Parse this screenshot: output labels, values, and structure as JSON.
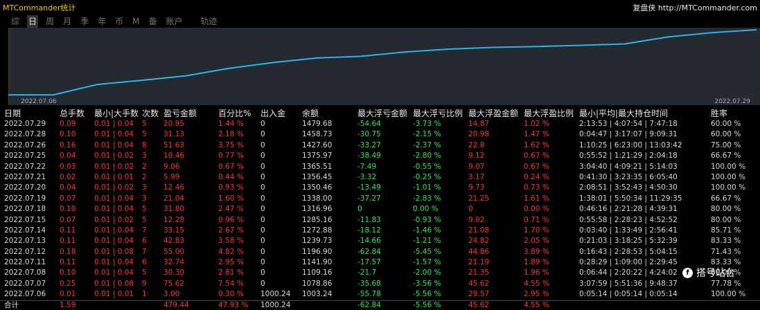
{
  "app_title": "MTCommander统计",
  "brand": {
    "name": "复盘侠",
    "url": "http://MTCommander.com"
  },
  "tabs": [
    "综",
    "日",
    "周",
    "月",
    "季",
    "年",
    "币",
    "M",
    "备",
    "账户",
    "轨迹"
  ],
  "active_tab": "日",
  "chart": {
    "start_date": "2022.07.06",
    "end_date": "2022.07.29",
    "line_color": "#29b6f0"
  },
  "columns": [
    "日期",
    "总手数",
    "最小|大手数",
    "次数",
    "盈亏金额",
    "百分比%",
    "出入金",
    "余额",
    "最大浮亏金额",
    "最大浮亏比例",
    "最大浮盈金额",
    "最大浮盈比例",
    "最小|平均|最大持仓时间",
    "胜率"
  ],
  "rows": [
    [
      "2022.07.29",
      "0.09",
      "0.01 | 0.04",
      "5",
      "20.95",
      "1.44 %",
      "0",
      "1479.68",
      "-54.64",
      "-3.73 %",
      "14.87",
      "1.02 %",
      "2:13:53 | 4:07:54 | 7:47:18",
      "60.00 %"
    ],
    [
      "2022.07.28",
      "0.10",
      "0.01 | 0.04",
      "5",
      "31.13",
      "2.18 %",
      "0",
      "1458.73",
      "-30.75",
      "-2.15 %",
      "20.98",
      "1.47 %",
      "0:04:47 | 3:17:07 | 9:09:31",
      "60.00 %"
    ],
    [
      "2022.07.26",
      "0.16",
      "0.01 | 0.04",
      "8",
      "51.63",
      "3.75 %",
      "0",
      "1427.60",
      "-33.27",
      "-2.37 %",
      "22.8",
      "1.62 %",
      "1:10:25 | 6:23:00 | 13:03:42",
      "75.00 %"
    ],
    [
      "2022.07.25",
      "0.04",
      "0.01 | 0.02",
      "3",
      "10.46",
      "0.77 %",
      "0",
      "1375.97",
      "-38.49",
      "-2.80 %",
      "9.12",
      "0.67 %",
      "0:55:52 | 1:21:29 | 2:04:18",
      "66.67 %"
    ],
    [
      "2022.07.22",
      "0.03",
      "0.01 | 0.02",
      "2",
      "9.06",
      "0.67 %",
      "0",
      "1365.51",
      "-7.49",
      "-0.55 %",
      "9.07",
      "0.67 %",
      "3:04:40 | 4:09:21 | 5:14:03",
      "100.00 %"
    ],
    [
      "2022.07.21",
      "0.02",
      "0.01 | 0.01",
      "2",
      "5.99",
      "0.44 %",
      "0",
      "1356.45",
      "-3.32",
      "-0.25 %",
      "3.17",
      "0.24 %",
      "0:41:30 | 3:23:35 | 6:05:40",
      "100.00 %"
    ],
    [
      "2022.07.20",
      "0.04",
      "0.01 | 0.02",
      "3",
      "12.46",
      "0.93 %",
      "0",
      "1350.46",
      "-13.49",
      "-1.01 %",
      "9.73",
      "0.73 %",
      "2:08:51 | 3:52:43 | 4:50:30",
      "100.00 %"
    ],
    [
      "2022.07.19",
      "0.07",
      "0.01 | 0.04",
      "3",
      "21.04",
      "1.60 %",
      "0",
      "1338.00",
      "-37.27",
      "-2.83 %",
      "21.25",
      "1.61 %",
      "1:38:01 | 5:50:34 | 11:29:35",
      "66.67 %"
    ],
    [
      "2022.07.18",
      "0.10",
      "0.01 | 0.04",
      "5",
      "31.80",
      "2.47 %",
      "0",
      "1316.96",
      "0",
      "0.00 %",
      "0",
      "0.00 %",
      "0:46:16 | 2:21:28 | 4:39:31",
      "80.00 %"
    ],
    [
      "2022.07.15",
      "0.07",
      "0.01 | 0.02",
      "5",
      "12.28",
      "0.96 %",
      "0",
      "1285.16",
      "-11.83",
      "-0.93 %",
      "9.02",
      "0.71 %",
      "0:55:58 | 2:28:23 | 4:52:52",
      "80.00 %"
    ],
    [
      "2022.07.14",
      "0.11",
      "0.01 | 0.04",
      "7",
      "33.15",
      "2.67 %",
      "0",
      "1272.88",
      "-18.12",
      "-1.46 %",
      "21.08",
      "1.70 %",
      "0:03:40 | 1:33:49 | 2:56:41",
      "85.71 %"
    ],
    [
      "2022.07.13",
      "0.11",
      "0.01 | 0.04",
      "6",
      "42.83",
      "3.58 %",
      "0",
      "1239.73",
      "-14.66",
      "-1.21 %",
      "24.82",
      "2.05 %",
      "0:21:03 | 3:18:25 | 5:32:39",
      "83.33 %"
    ],
    [
      "2022.07.12",
      "0.18",
      "0.01 | 0.08",
      "7",
      "55.00",
      "4.82 %",
      "0",
      "1196.90",
      "-62.84",
      "-5.45 %",
      "44.86",
      "3.89 %",
      "0:16:43 | 2:28:53 | 5:04:15",
      "71.43 %"
    ],
    [
      "2022.07.11",
      "0.11",
      "0.01 | 0.04",
      "6",
      "32.74",
      "2.95 %",
      "0",
      "1141.90",
      "-17.57",
      "-1.57 %",
      "21.19",
      "1.89 %",
      "0:28:29 | 1:09:00 | 2:29:45",
      "83.33 %"
    ],
    [
      "2022.07.08",
      "0.10",
      "0.01 | 0.04",
      "5",
      "30.30",
      "2.81 %",
      "0",
      "1109.16",
      "-21.7",
      "-2.00 %",
      "21.35",
      "1.96 %",
      "0:06:44 | 2:20:22 | 4:24:02",
      "80.00 %"
    ],
    [
      "2022.07.07",
      "0.25",
      "0.01 | 0.08",
      "9",
      "75.62",
      "7.54 %",
      "0",
      "1078.86",
      "-35.68",
      "-3.56 %",
      "45.62",
      "4.55 %",
      "3:07:59 | 5:51:36 | 9:48:37",
      "77.78 %"
    ],
    [
      "2022.07.06",
      "0.01",
      "0.01 | 0.01",
      "1",
      "3.00",
      "0.30 %",
      "1000.24",
      "1003.24",
      "-55.78",
      "-5.56 %",
      "29.57",
      "2.95 %",
      "0:05:14 | 0:05:14 | 0:05:14",
      "100.00 %"
    ]
  ],
  "total": [
    "合计",
    "1.59",
    "",
    "",
    "479.44",
    "47.93 %",
    "1000.24",
    "",
    "-62.84",
    "-5.56 %",
    "45.62",
    "4.55 %",
    "",
    ""
  ],
  "watermark": "搭号站台",
  "balance_series": [
    1003.24,
    1078.86,
    1109.16,
    1141.9,
    1196.9,
    1239.73,
    1272.88,
    1285.16,
    1316.96,
    1338.0,
    1350.46,
    1356.45,
    1365.51,
    1375.97,
    1427.6,
    1458.73,
    1479.68
  ],
  "colors": {
    "title": "#e8c800",
    "profit": "#ff3333",
    "loss": "#22ee55",
    "chart_bg": "#252a31"
  }
}
